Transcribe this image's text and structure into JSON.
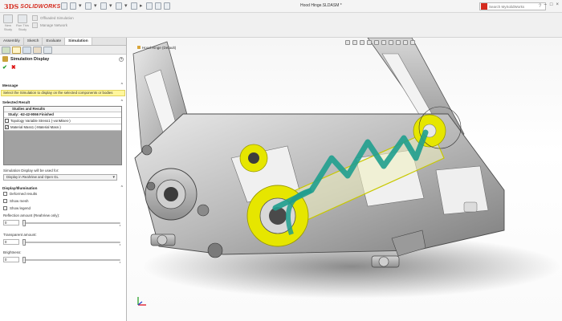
{
  "titlebar": {
    "logo_ds": "3DS",
    "logo_text": "SOLIDWORKS",
    "file_title": "Hood Hinge.SLDASM *",
    "search_placeholder": "Search MySolidWorks",
    "help_glyph": "?",
    "window_buttons": [
      "–",
      "□",
      "×"
    ]
  },
  "ribbon": {
    "new_study": "New Study",
    "run_this_study": "Run This Study",
    "offloaded_simulation": "Offloaded Simulation",
    "manage_network": "Manage Network"
  },
  "tabs": [
    "Assembly",
    "Sketch",
    "Evaluate",
    "Simulation"
  ],
  "active_tab": "Simulation",
  "property_manager": {
    "title": "Simulation Display",
    "help": "?",
    "ok": "✔",
    "cancel": "✖"
  },
  "message": {
    "header": "Message",
    "text": "Select the Simulation to display on the selected components or bodies"
  },
  "selected_result": {
    "header": "Selected Result",
    "table_header": "Studies and Results",
    "study": "Study: -62-42-9066 Finished",
    "items": [
      {
        "label": "Topology Variable Stress1 (-vonMises-)",
        "checked": false
      },
      {
        "label": "Material Mass1 (-Material Mass-)",
        "checked": true
      }
    ]
  },
  "display_used_for": {
    "label": "Simulation Display will be used for:",
    "value": "Display in RealView and Open GL"
  },
  "display_illumination": {
    "header": "Display/Illumination",
    "checkboxes": [
      "Deformed results",
      "Show mesh",
      "Show legend"
    ],
    "reflection_label": "Reflection amount (RealView only):",
    "reflection_value": "0",
    "transparent_label": "Transparent amount:",
    "transparent_value": "0",
    "brightness_label": "Brightness:",
    "brightness_value": "0"
  },
  "viewport": {
    "tree_caption": "Hood Hinge (Default)"
  },
  "colors": {
    "brand_red": "#d52b1e",
    "message_yellow": "#fff69c",
    "result_yellow": "#e6e600",
    "result_teal": "#1f9e8e"
  },
  "icons": [
    "solidworks-logo-icon",
    "search-icon",
    "ok-check-icon",
    "cancel-x-icon",
    "help-icon",
    "triad-icon"
  ]
}
